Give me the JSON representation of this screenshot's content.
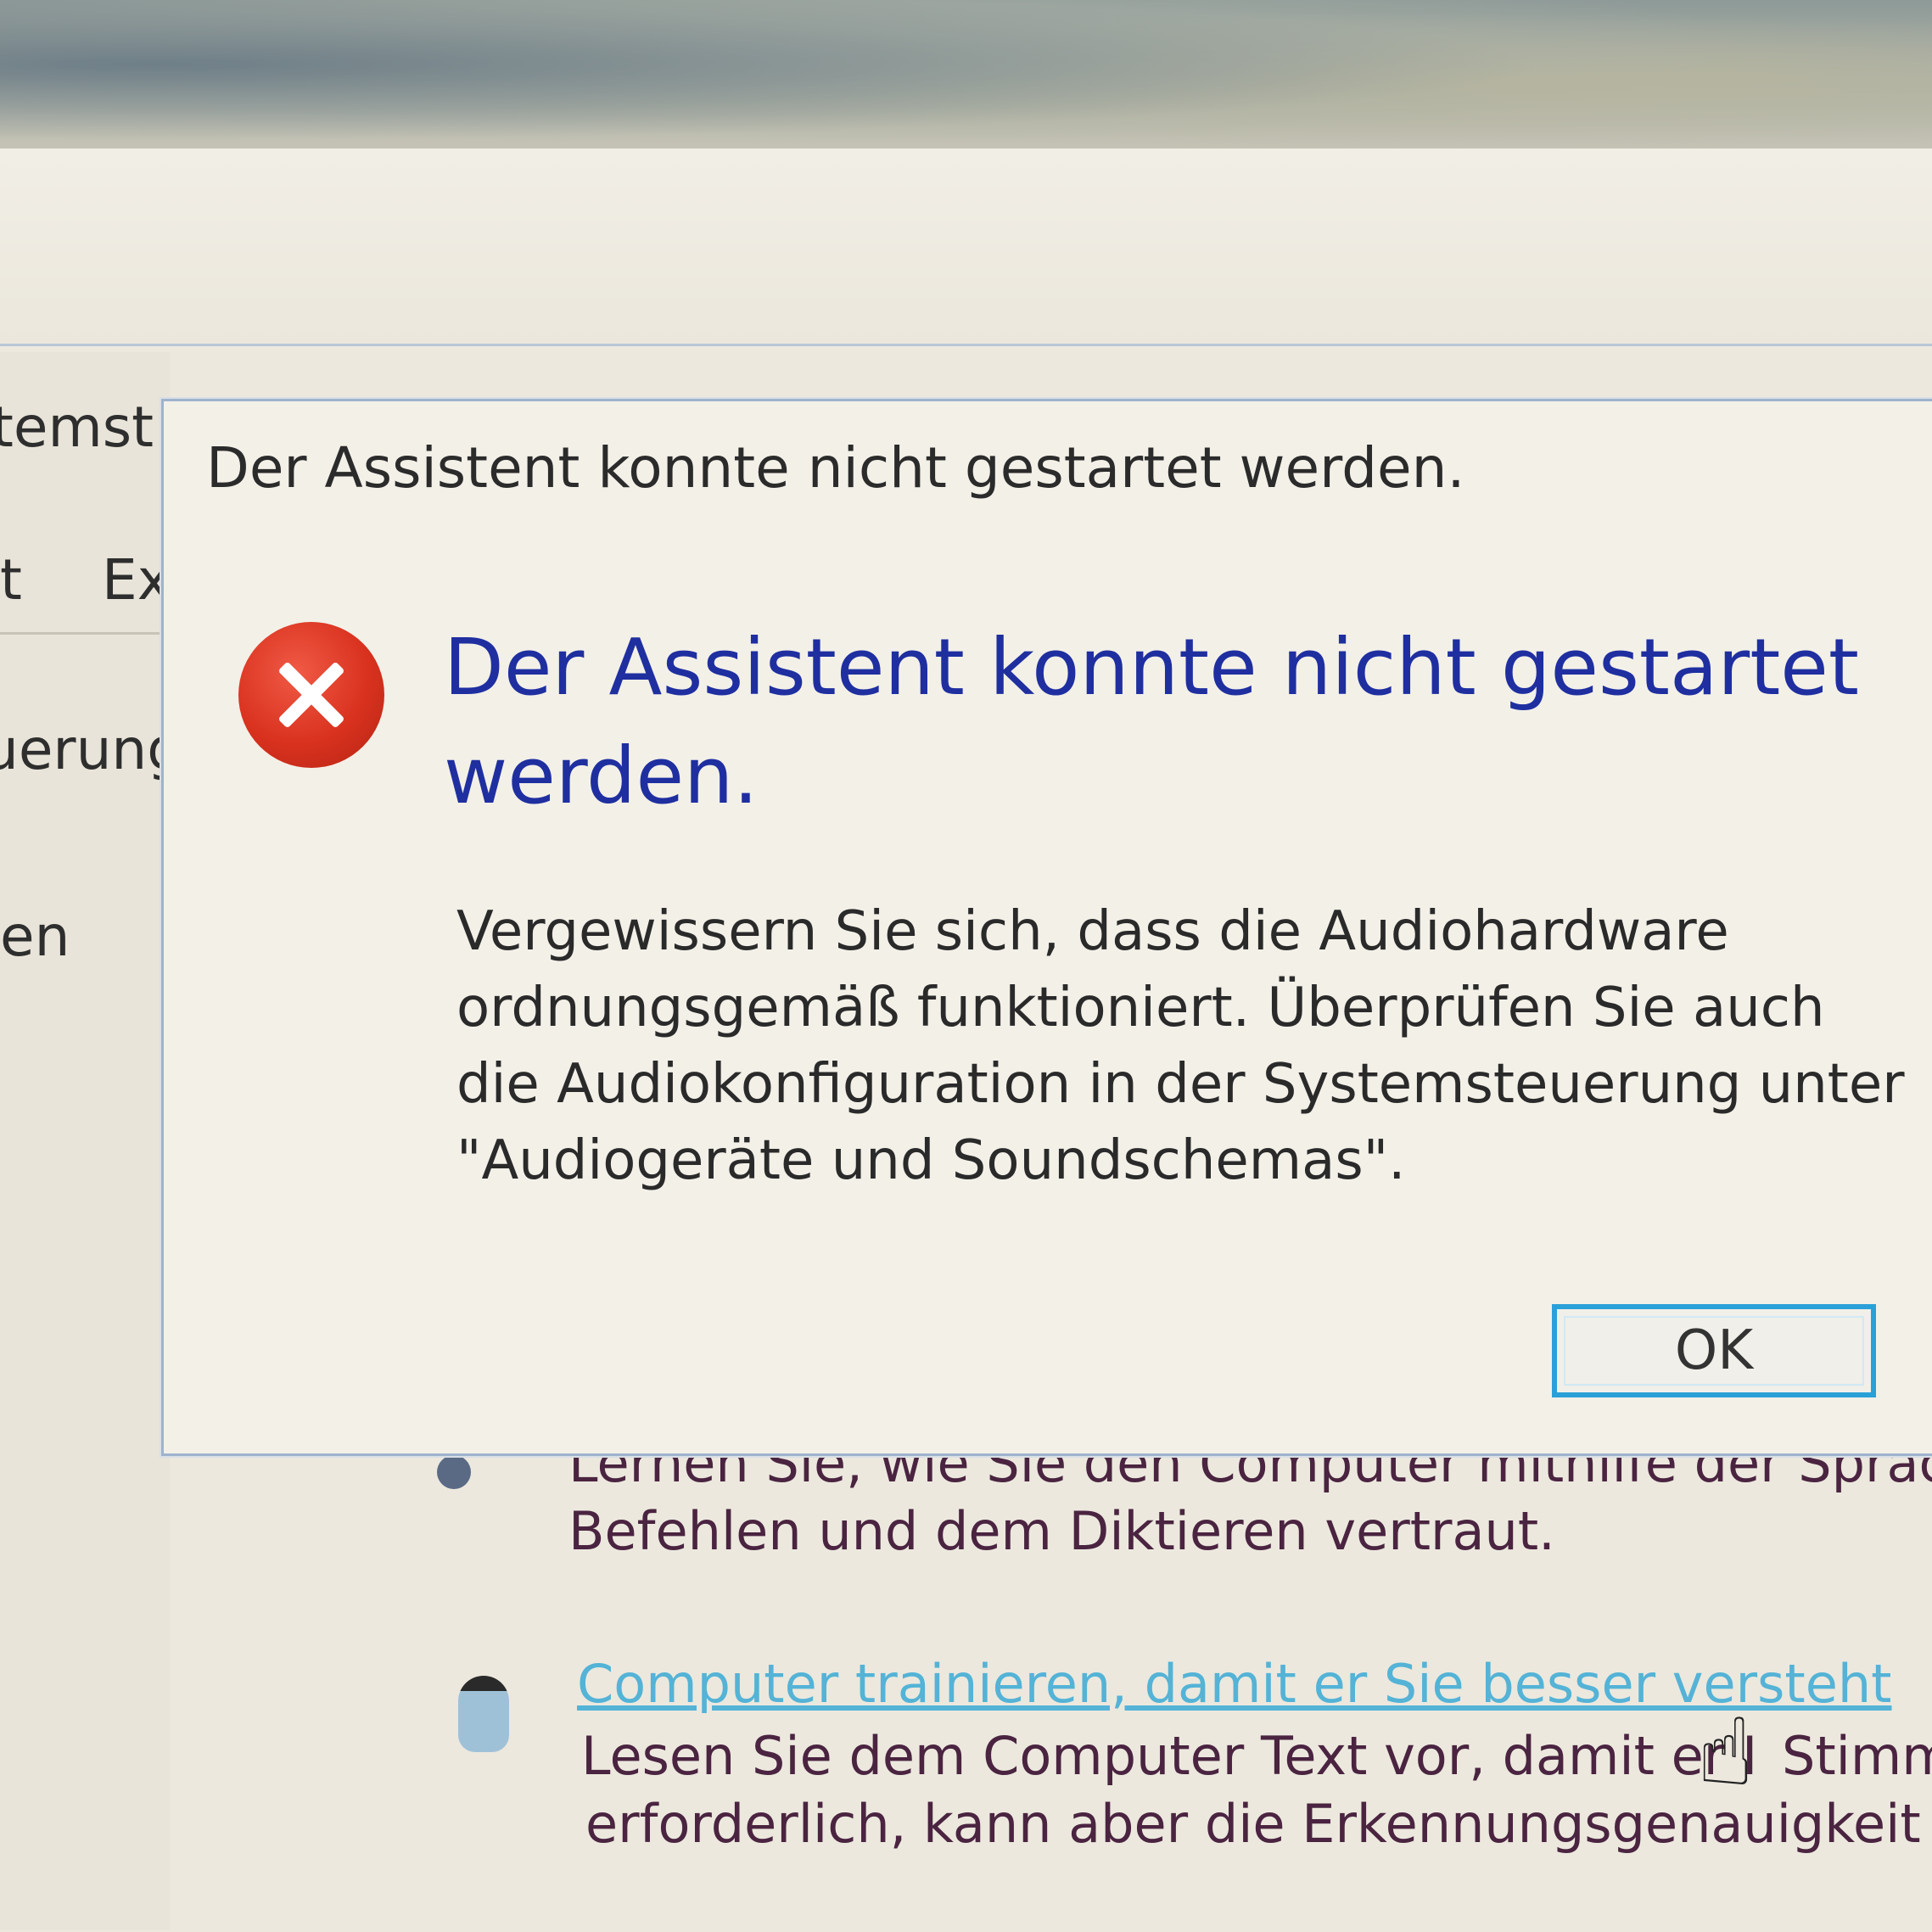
{
  "background": {
    "sidebar": {
      "fragments": [
        "temst",
        "t",
        "Ext",
        "uerung",
        "en"
      ]
    },
    "items": [
      {
        "text_line1": "Lernen Sie, wie Sie den Computer mithilfe der Sprach",
        "text_line2": "Befehlen und dem Diktieren vertraut."
      },
      {
        "link": "Computer trainieren, damit er Sie besser versteht",
        "text_line1": "Lesen Sie dem Computer Text vor, damit er I",
        "text_line1_end": "Stimm",
        "text_line2": "erforderlich, kann aber die Erkennungsgenauigkeit be"
      }
    ]
  },
  "dialog": {
    "title": "Der Assistent konnte nicht gestartet werden.",
    "main_instruction": "Der Assistent konnte nicht gestartet werden.",
    "content": "Vergewissern Sie sich, dass die Audiohardware ordnungsgemäß funktioniert. Überprüfen Sie auch die Audiokonfiguration in der Systemsteuerung unter \"Audiogeräte und Soundschemas\".",
    "ok_label": "OK",
    "icon": "error-icon"
  },
  "colors": {
    "main_instruction": "#1f2fa0",
    "error_red": "#d9321f",
    "ok_border": "#2aa0d8",
    "link": "#54b3d6"
  }
}
